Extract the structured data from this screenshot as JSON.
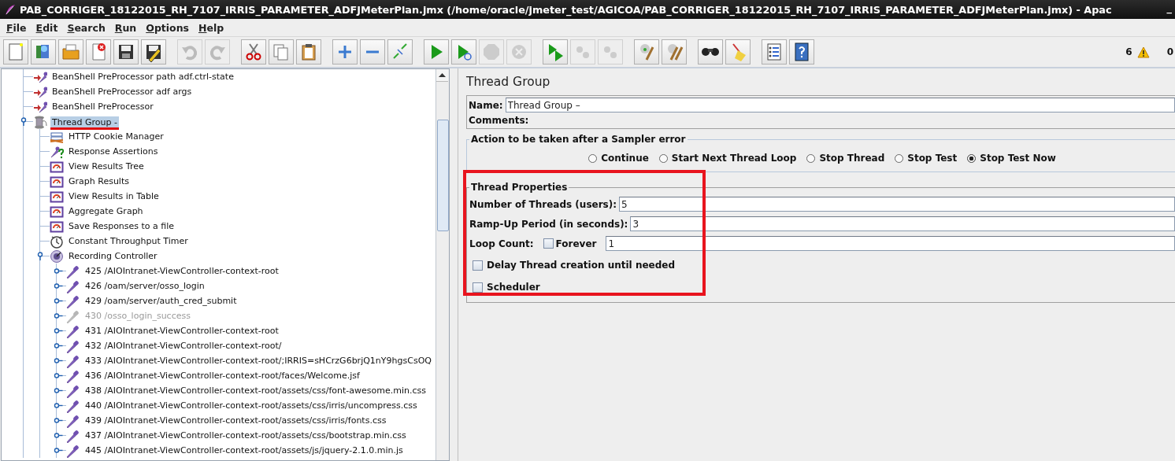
{
  "window": {
    "title": "PAB_CORRIGER_18122015_RH_7107_IRRIS_PARAMETER_ADFJMeterPlan.jmx (/home/oracle/jmeter_test/AGICOA/PAB_CORRIGER_18122015_RH_7107_IRRIS_PARAMETER_ADFJMeterPlan.jmx) - Apac",
    "minimize": "_"
  },
  "menu": [
    "File",
    "Edit",
    "Search",
    "Run",
    "Options",
    "Help"
  ],
  "toolbar": {
    "groups": [
      [
        {
          "kind": "new",
          "disabled": false
        },
        {
          "kind": "templates",
          "disabled": false
        },
        {
          "kind": "open",
          "disabled": false
        },
        {
          "kind": "close",
          "disabled": false
        },
        {
          "kind": "save",
          "disabled": false
        },
        {
          "kind": "save-as",
          "disabled": false
        }
      ],
      [
        {
          "kind": "undo",
          "disabled": true
        },
        {
          "kind": "redo",
          "disabled": true
        }
      ],
      [
        {
          "kind": "cut",
          "disabled": false
        },
        {
          "kind": "copy",
          "disabled": false
        },
        {
          "kind": "paste",
          "disabled": false
        }
      ],
      [
        {
          "kind": "expand",
          "disabled": false
        },
        {
          "kind": "collapse",
          "disabled": false
        },
        {
          "kind": "toggle",
          "disabled": false
        }
      ],
      [
        {
          "kind": "start",
          "disabled": false
        },
        {
          "kind": "start-no-pause",
          "disabled": false
        },
        {
          "kind": "stop",
          "disabled": true
        },
        {
          "kind": "shutdown",
          "disabled": true
        }
      ],
      [
        {
          "kind": "remote-start",
          "disabled": false
        },
        {
          "kind": "remote-stop",
          "disabled": true
        },
        {
          "kind": "remote-exit",
          "disabled": true
        }
      ],
      [
        {
          "kind": "clear",
          "disabled": false
        },
        {
          "kind": "clear-all",
          "disabled": false
        }
      ],
      [
        {
          "kind": "search",
          "disabled": false
        },
        {
          "kind": "reset-search",
          "disabled": false
        }
      ],
      [
        {
          "kind": "function-helper",
          "disabled": false
        },
        {
          "kind": "help",
          "disabled": false
        }
      ]
    ],
    "warning_count": "6",
    "error_count": "0"
  },
  "tree": {
    "items": [
      {
        "label": "BeanShell PreProcessor path adf.ctrl-state",
        "kind": "preprocessor",
        "selected": false,
        "disabled": false,
        "underlined": false
      },
      {
        "label": "BeanShell PreProcessor adf args",
        "kind": "preprocessor",
        "selected": false,
        "disabled": false,
        "underlined": false
      },
      {
        "label": "BeanShell PreProcessor",
        "kind": "preprocessor",
        "selected": false,
        "disabled": false,
        "underlined": false
      },
      {
        "label": "Thread Group -",
        "kind": "thread-group",
        "selected": true,
        "disabled": false,
        "underlined": true,
        "expanded": true,
        "children": [
          {
            "label": "HTTP Cookie Manager",
            "kind": "config",
            "selected": false,
            "disabled": false,
            "underlined": false
          },
          {
            "label": "Response Assertions",
            "kind": "assertion",
            "selected": false,
            "disabled": false,
            "underlined": false
          },
          {
            "label": "View Results Tree",
            "kind": "listener",
            "selected": false,
            "disabled": false,
            "underlined": false
          },
          {
            "label": "Graph Results",
            "kind": "listener",
            "selected": false,
            "disabled": false,
            "underlined": false
          },
          {
            "label": "View Results in Table",
            "kind": "listener",
            "selected": false,
            "disabled": false,
            "underlined": false
          },
          {
            "label": "Aggregate Graph",
            "kind": "listener",
            "selected": false,
            "disabled": false,
            "underlined": false
          },
          {
            "label": "Save Responses to a file",
            "kind": "listener",
            "selected": false,
            "disabled": false,
            "underlined": false
          },
          {
            "label": "Constant Throughput Timer",
            "kind": "timer",
            "selected": false,
            "disabled": false,
            "underlined": false
          },
          {
            "label": "Recording Controller",
            "kind": "controller",
            "selected": false,
            "disabled": false,
            "underlined": false,
            "expanded": true,
            "children": [
              {
                "label": "425 /AIOIntranet-ViewController-context-root",
                "kind": "sampler",
                "selected": false,
                "disabled": false,
                "underlined": false,
                "expanded": false
              },
              {
                "label": "426 /oam/server/osso_login",
                "kind": "sampler",
                "selected": false,
                "disabled": false,
                "underlined": false,
                "expanded": false
              },
              {
                "label": "429 /oam/server/auth_cred_submit",
                "kind": "sampler",
                "selected": false,
                "disabled": false,
                "underlined": false,
                "expanded": false
              },
              {
                "label": "430 /osso_login_success",
                "kind": "sampler",
                "selected": false,
                "disabled": true,
                "underlined": false,
                "expanded": false
              },
              {
                "label": "431 /AIOIntranet-ViewController-context-root",
                "kind": "sampler",
                "selected": false,
                "disabled": false,
                "underlined": false,
                "expanded": false
              },
              {
                "label": "432 /AIOIntranet-ViewController-context-root/",
                "kind": "sampler",
                "selected": false,
                "disabled": false,
                "underlined": false,
                "expanded": false
              },
              {
                "label": "433 /AIOIntranet-ViewController-context-root/;IRRIS=sHCrzG6brjQ1nY9hgsCsOQ",
                "kind": "sampler",
                "selected": false,
                "disabled": false,
                "underlined": false,
                "expanded": false
              },
              {
                "label": "436 /AIOIntranet-ViewController-context-root/faces/Welcome.jsf",
                "kind": "sampler",
                "selected": false,
                "disabled": false,
                "underlined": false,
                "expanded": false
              },
              {
                "label": "438 /AIOIntranet-ViewController-context-root/assets/css/font-awesome.min.css",
                "kind": "sampler",
                "selected": false,
                "disabled": false,
                "underlined": false,
                "expanded": false
              },
              {
                "label": "440 /AIOIntranet-ViewController-context-root/assets/css/irris/uncompress.css",
                "kind": "sampler",
                "selected": false,
                "disabled": false,
                "underlined": false,
                "expanded": false
              },
              {
                "label": "439 /AIOIntranet-ViewController-context-root/assets/css/irris/fonts.css",
                "kind": "sampler",
                "selected": false,
                "disabled": false,
                "underlined": false,
                "expanded": false
              },
              {
                "label": "437 /AIOIntranet-ViewController-context-root/assets/css/bootstrap.min.css",
                "kind": "sampler",
                "selected": false,
                "disabled": false,
                "underlined": false,
                "expanded": false
              },
              {
                "label": "445 /AIOIntranet-ViewController-context-root/assets/js/jquery-2.1.0.min.js",
                "kind": "sampler",
                "selected": false,
                "disabled": false,
                "underlined": false,
                "expanded": false
              }
            ]
          }
        ]
      }
    ]
  },
  "panel": {
    "title": "Thread Group",
    "name_label": "Name:",
    "name_value": "Thread Group –",
    "comments_label": "Comments:",
    "error_action": {
      "legend": "Action to be taken after a Sampler error",
      "options": [
        {
          "label": "Continue",
          "selected": false
        },
        {
          "label": "Start Next Thread Loop",
          "selected": false
        },
        {
          "label": "Stop Thread",
          "selected": false
        },
        {
          "label": "Stop Test",
          "selected": false
        },
        {
          "label": "Stop Test Now",
          "selected": true
        }
      ]
    },
    "thread_properties": {
      "legend": "Thread Properties",
      "highlighted": true,
      "threads_label": "Number of Threads (users):",
      "threads_value": "5",
      "rampup_label": "Ramp-Up Period (in seconds):",
      "rampup_value": "3",
      "loop_label": "Loop Count:",
      "forever": {
        "label": "Forever",
        "checked": false
      },
      "loop_value": "1",
      "delay": {
        "label": "Delay Thread creation until needed",
        "checked": false
      },
      "scheduler": {
        "label": "Scheduler",
        "checked": false
      }
    }
  }
}
